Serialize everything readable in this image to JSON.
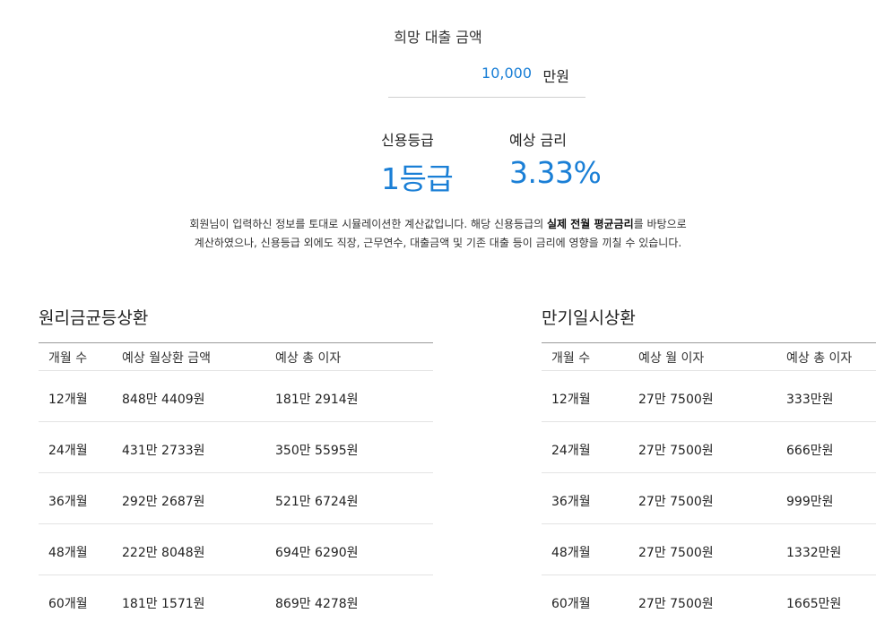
{
  "loan": {
    "label": "희망 대출 금액",
    "amount": "10,000",
    "unit": "만원"
  },
  "grade": {
    "label": "신용등급",
    "value": "1등급"
  },
  "rate": {
    "label": "예상 금리",
    "value": "3.33%"
  },
  "notice": {
    "line1_a": "회원님이 입력하신 정보를 토대로 시뮬레이션한 계산값입니다. 해당 신용등급의 ",
    "line1_bold": "실제 전월 평균금리",
    "line1_b": "를 바탕으로",
    "line2": "계산하였으나, 신용등급 외에도 직장, 근무연수, 대출금액 및 기존 대출 등이 금리에 영향을 끼칠 수 있습니다."
  },
  "equal_principal": {
    "title": "원리금균등상환",
    "headers": [
      "개월 수",
      "예상 월상환 금액",
      "예상 총 이자"
    ],
    "rows": [
      [
        "12개월",
        "848만 4409원",
        "181만 2914원"
      ],
      [
        "24개월",
        "431만 2733원",
        "350만 5595원"
      ],
      [
        "36개월",
        "292만 2687원",
        "521만 6724원"
      ],
      [
        "48개월",
        "222만 8048원",
        "694만 6290원"
      ],
      [
        "60개월",
        "181만 1571원",
        "869만 4278원"
      ]
    ]
  },
  "bullet": {
    "title": "만기일시상환",
    "headers": [
      "개월 수",
      "예상 월 이자",
      "예상 총 이자"
    ],
    "rows": [
      [
        "12개월",
        "27만 7500원",
        "333만원"
      ],
      [
        "24개월",
        "27만 7500원",
        "666만원"
      ],
      [
        "36개월",
        "27만 7500원",
        "999만원"
      ],
      [
        "48개월",
        "27만 7500원",
        "1332만원"
      ],
      [
        "60개월",
        "27만 7500원",
        "1665만원"
      ]
    ]
  },
  "colors": {
    "accent": "#1a7fd6",
    "text": "#222222",
    "divider": "#e3e3e3"
  }
}
